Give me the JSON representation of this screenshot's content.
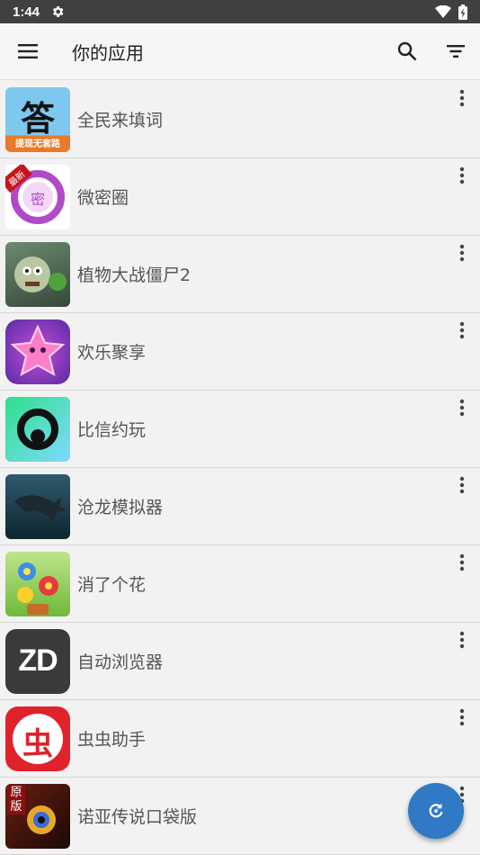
{
  "status_bar": {
    "time": "1:44"
  },
  "app_bar": {
    "title": "你的应用"
  },
  "apps": [
    {
      "name": "全民来填词",
      "icon": "answer-game-icon",
      "icon_text": "答",
      "icon_sub": "提现无套路"
    },
    {
      "name": "微密圈",
      "icon": "weimiquan-icon",
      "icon_text": "密",
      "icon_badge": "最新"
    },
    {
      "name": "植物大战僵尸2",
      "icon": "zombie-game-icon"
    },
    {
      "name": "欢乐聚享",
      "icon": "star-game-icon"
    },
    {
      "name": "比信约玩",
      "icon": "bixin-icon"
    },
    {
      "name": "沧龙模拟器",
      "icon": "mosasaur-icon"
    },
    {
      "name": "消了个花",
      "icon": "flower-game-icon"
    },
    {
      "name": "自动浏览器",
      "icon": "zd-browser-icon",
      "icon_text": "ZD"
    },
    {
      "name": "虫虫助手",
      "icon": "chongchong-icon",
      "icon_text": "虫"
    },
    {
      "name": "诺亚传说口袋版",
      "icon": "noah-legend-icon",
      "icon_text": "原版"
    }
  ]
}
